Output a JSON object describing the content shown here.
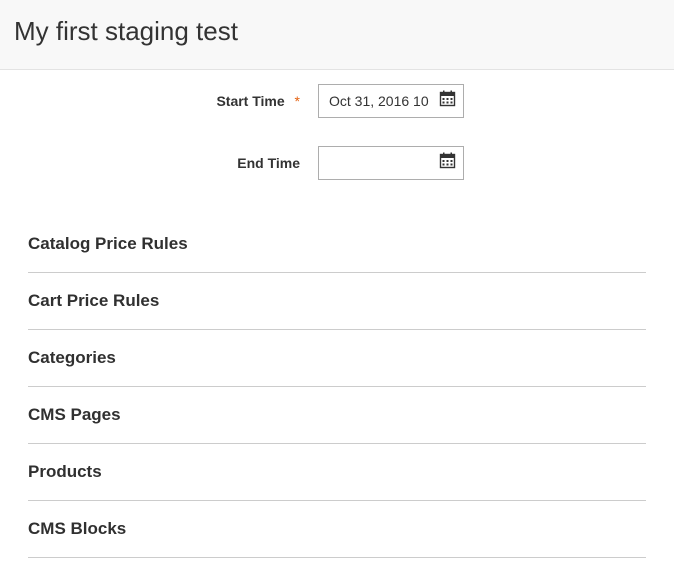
{
  "header": {
    "title": "My first staging test"
  },
  "form": {
    "start_time": {
      "label": "Start Time",
      "required": true,
      "value": "Oct 31, 2016 10"
    },
    "end_time": {
      "label": "End Time",
      "required": false,
      "value": ""
    }
  },
  "sections": [
    {
      "label": "Catalog Price Rules"
    },
    {
      "label": "Cart Price Rules"
    },
    {
      "label": "Categories"
    },
    {
      "label": "CMS Pages"
    },
    {
      "label": "Products"
    },
    {
      "label": "CMS Blocks"
    }
  ]
}
